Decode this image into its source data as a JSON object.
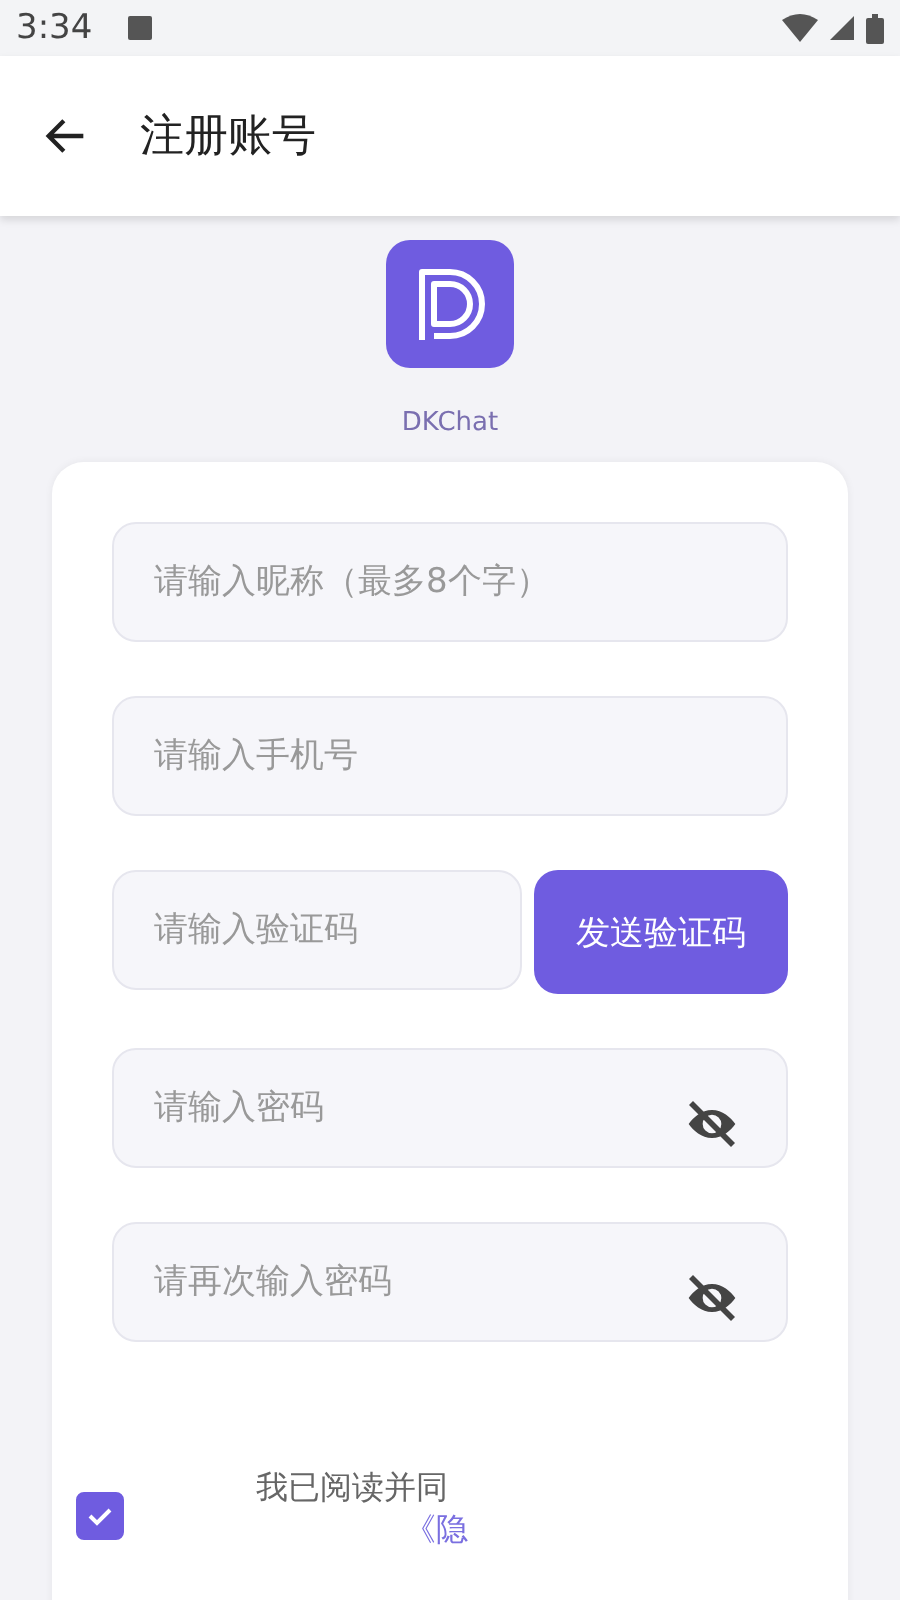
{
  "status_bar": {
    "time": "3:34"
  },
  "app_bar": {
    "title": "注册账号"
  },
  "app": {
    "name": "DKChat"
  },
  "fields": [
    {
      "kind": "text",
      "placeholder": "请输入昵称（最多8个字）"
    },
    {
      "kind": "text",
      "placeholder": "请输入手机号"
    },
    {
      "kind": "code",
      "placeholder": "请输入验证码",
      "button": "发送验证码"
    },
    {
      "kind": "password",
      "placeholder": "请输入密码"
    },
    {
      "kind": "password",
      "placeholder": "请再次输入密码"
    }
  ],
  "agreement": {
    "checked": true,
    "text": "我已阅读并同",
    "link": "《隐"
  }
}
